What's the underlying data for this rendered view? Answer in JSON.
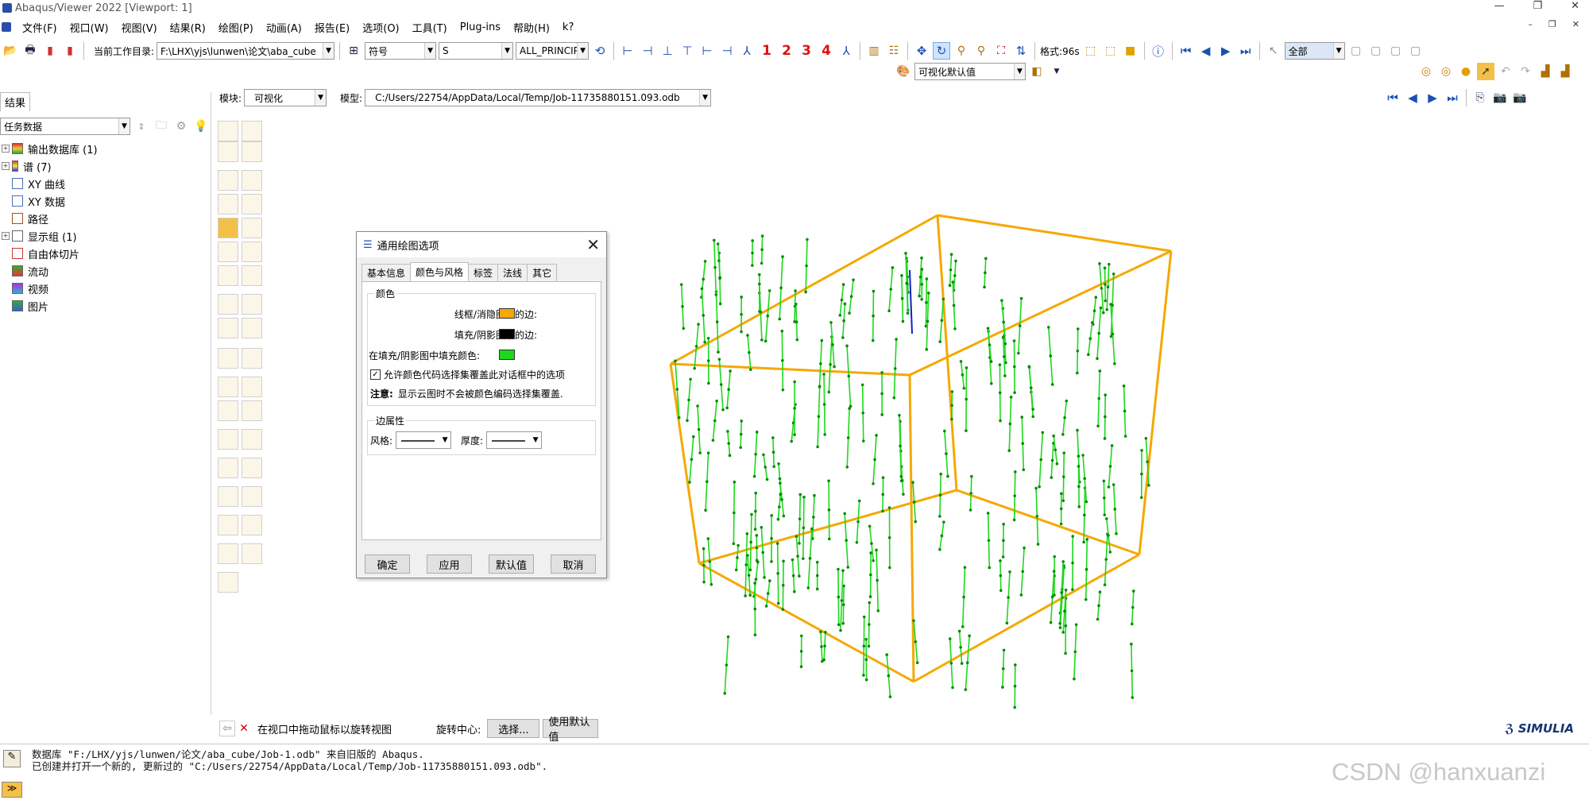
{
  "window": {
    "title": "Abaqus/Viewer 2022 [Viewport: 1]",
    "min": "—",
    "restore": "❐",
    "close": "✕"
  },
  "menu": [
    "文件(F)",
    "视口(W)",
    "视图(V)",
    "结果(R)",
    "绘图(P)",
    "动画(A)",
    "报告(E)",
    "选项(O)",
    "工具(T)",
    "Plug-ins",
    "帮助(H)",
    "k?"
  ],
  "toolbar": {
    "workdir_label": "当前工作目录:",
    "workdir_value": "F:\\LHX\\yjs\\lunwen\\论文\\aba_cube",
    "symbol_value": "符号",
    "field_value": "S",
    "invariant_value": "ALL_PRINCIPAL",
    "scale_label": "格式:96s",
    "display_group_value": "全部",
    "view_defaults_value": "可视化默认值",
    "axis_numbers": [
      "1",
      "2",
      "3",
      "4"
    ]
  },
  "context": {
    "module_label": "模块:",
    "module_value": "可视化",
    "model_label": "模型:",
    "model_value": "C:/Users/22754/AppData/Local/Temp/Job-11735880151.093.odb"
  },
  "left": {
    "tab": "结果",
    "filter_value": "任务数据",
    "tree": [
      {
        "label": "输出数据库 (1)",
        "expand": "+"
      },
      {
        "label": "谱 (7)",
        "expand": "+"
      },
      {
        "label": "XY 曲线",
        "expand": ""
      },
      {
        "label": "XY 数据",
        "expand": ""
      },
      {
        "label": "路径",
        "expand": ""
      },
      {
        "label": "显示组 (1)",
        "expand": "+"
      },
      {
        "label": "自由体切片",
        "expand": ""
      },
      {
        "label": "流动",
        "expand": ""
      },
      {
        "label": "视频",
        "expand": ""
      },
      {
        "label": "图片",
        "expand": ""
      }
    ]
  },
  "dialog": {
    "title": "通用绘图选项",
    "tabs": [
      "基本信息",
      "颜色与风格",
      "标签",
      "法线",
      "其它"
    ],
    "active_tab": 1,
    "color_group": "颜色",
    "edge_wire_label": "线框/消隐图中的边:",
    "edge_wire_color": "#f5a800",
    "edge_fill_label": "填充/阴影图中的边:",
    "edge_fill_color": "#000000",
    "fill_color_label": "在填充/阴影图中填充颜色:",
    "fill_color": "#1ed81e",
    "allow_override_label": "允许颜色代码选择集覆盖此对话框中的选项",
    "allow_override_checked": true,
    "note_label": "注意:",
    "note_text": "显示云图时不会被颜色编码选择集覆盖.",
    "edge_group": "边属性",
    "style_label": "风格:",
    "thickness_label": "厚度:",
    "buttons": [
      "确定",
      "应用",
      "默认值",
      "取消"
    ]
  },
  "prompt": {
    "text": "在视口中拖动鼠标以旋转视图",
    "center_label": "旋转中心:",
    "select_btn": "选择...",
    "default_btn": "使用默认值"
  },
  "messages": [
    "数据库 \"F:/LHX/yjs/lunwen/论文/aba_cube/Job-1.odb\" 来自旧版的 Abaqus.",
    "已创建并打开一个新的, 更新过的 \"C:/Users/22754/AppData/Local/Temp/Job-11735880151.093.odb\"."
  ],
  "brand": "SIMULIA",
  "watermark": "CSDN @hanxuanzi",
  "colors": {
    "cube_edge": "#f5a800",
    "fiber": "#1ed81e",
    "fiber_node": "#0a8a0a",
    "axis": "#1020d0"
  }
}
